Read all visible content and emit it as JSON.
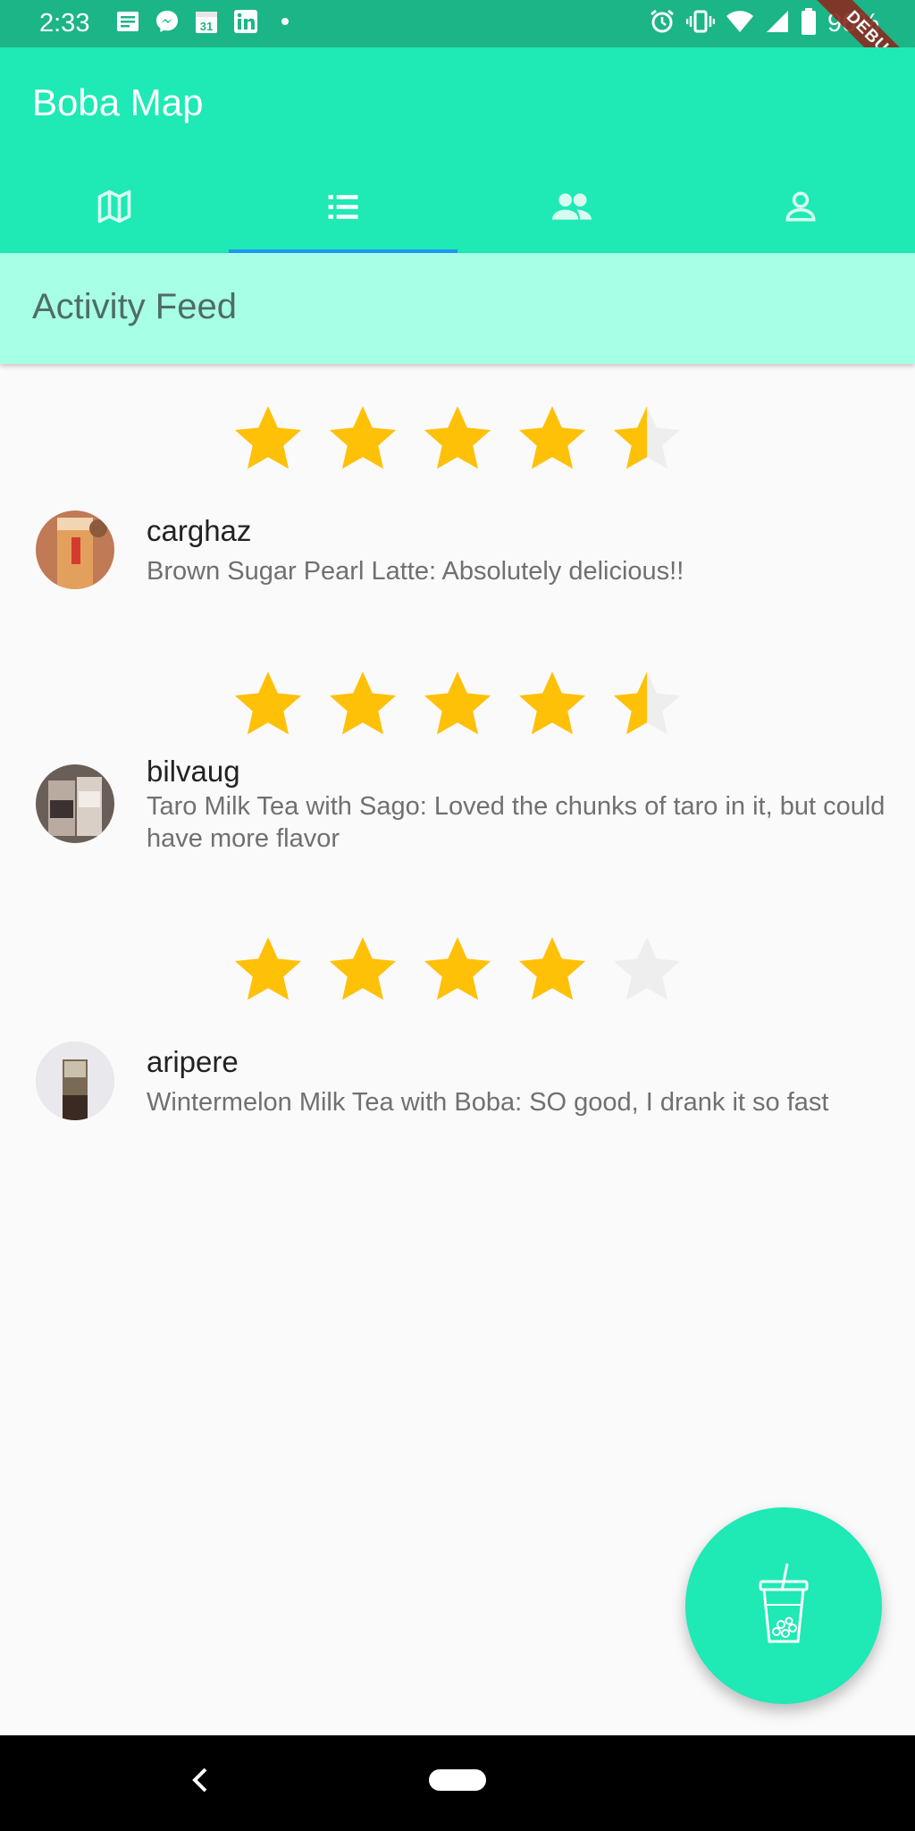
{
  "status_bar": {
    "time": "2:33",
    "battery": "96%",
    "left_icons": [
      "notes-icon",
      "messenger-icon",
      "calendar-icon",
      "linkedin-icon",
      "dot-icon"
    ],
    "right_icons": [
      "alarm-icon",
      "vibrate-icon",
      "wifi-icon",
      "signal-icon",
      "battery-icon"
    ]
  },
  "debug_label": "DEBUG",
  "app_bar": {
    "title": "Boba Map",
    "tabs": [
      {
        "icon": "map-icon",
        "active": false
      },
      {
        "icon": "list-icon",
        "active": true
      },
      {
        "icon": "people-icon",
        "active": false
      },
      {
        "icon": "person-icon",
        "active": false
      }
    ]
  },
  "section": {
    "title": "Activity Feed"
  },
  "feed": [
    {
      "username": "carghaz",
      "review": "Brown Sugar Pearl Latte: Absolutely delicious!!",
      "rating": 4.5
    },
    {
      "username": "bilvaug",
      "review": "Taro Milk Tea with Sago: Loved the chunks of taro in it, but could have more flavor",
      "rating": 4.5
    },
    {
      "username": "aripere",
      "review": "Wintermelon Milk Tea with Boba: SO good, I drank it so fast",
      "rating": 4
    }
  ],
  "fab": {
    "icon": "boba-cup-icon"
  },
  "colors": {
    "accent": "#1fe9b5",
    "header_bg": "#a7ffe6",
    "star": "#ffc107",
    "star_empty": "#eeeeee",
    "tab_indicator": "#2196f3"
  }
}
